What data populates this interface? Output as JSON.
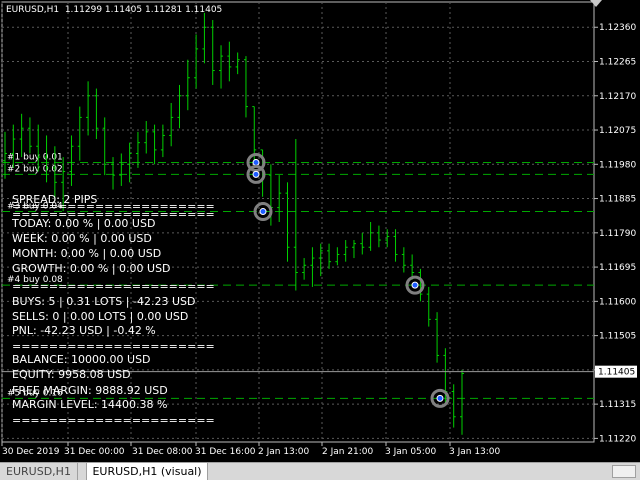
{
  "header": {
    "symbol_info": "EURUSD,H1  1.11299 1.11405 1.11281 1.11405"
  },
  "price_axis": {
    "labels": [
      "1.12360",
      "1.12265",
      "1.12170",
      "1.12075",
      "1.11980",
      "1.11885",
      "1.11790",
      "1.11695",
      "1.11600",
      "1.11505",
      "1.11410",
      "1.11315",
      "1.11220"
    ],
    "current_price": "1.11405"
  },
  "time_axis": {
    "labels": [
      "30 Dec 2019",
      "31 Dec 00:00",
      "31 Dec 08:00",
      "31 Dec 16:00",
      "2 Jan 13:00",
      "2 Jan 21:00",
      "3 Jan 05:00",
      "3 Jan 13:00"
    ]
  },
  "orders": [
    {
      "label": "#1 buy 0.01",
      "price": 1.11985
    },
    {
      "label": "#2 buy 0.02",
      "price": 1.11952
    },
    {
      "label": "#3 buy 0.04",
      "price": 1.11849
    },
    {
      "label": "#4 buy 0.08",
      "price": 1.11645
    },
    {
      "label": "#5 buy 0.16",
      "price": 1.11331
    }
  ],
  "stats_panel": {
    "lines": [
      "======================",
      "SPREAD: 2 PIPS",
      "======================",
      "TODAY: 0.00 % | 0.00 USD",
      "WEEK: 0.00 % | 0.00 USD",
      "MONTH: 0.00 % | 0.00 USD",
      "GROWTH: 0.00 % | 0.00 USD",
      "======================",
      "BUYS: 5 | 0.31 LOTS | -42.23 USD",
      "SELLS: 0 | 0.00 LOTS | 0.00 USD",
      "PNL: -42.23 USD | -0.42 %",
      "======================",
      "BALANCE: 10000.00 USD",
      "EQUITY: 9958.08 USD",
      "FREE MARGIN: 9888.92 USD",
      "MARGIN LEVEL: 14400.38 %",
      "======================"
    ]
  },
  "tabs": [
    {
      "label": "EURUSD,H1",
      "active": false
    },
    {
      "label": "EURUSD,H1 (visual)",
      "active": true
    }
  ],
  "colors": {
    "background": "#000000",
    "grid": "#5a5a5a",
    "candle": "#00d000",
    "order_line": "#00a800",
    "entry_marker_ring": "#808080",
    "entry_marker_dot": "#1e5cff",
    "price_tag_bg": "#ffffff"
  },
  "chart_data": {
    "type": "line",
    "title": "EURUSD,H1",
    "x": [
      "30 Dec 2019",
      "31 Dec 00:00",
      "31 Dec 08:00",
      "31 Dec 16:00",
      "2 Jan 13:00",
      "2 Jan 21:00",
      "3 Jan 05:00",
      "3 Jan 13:00"
    ],
    "ylim": [
      1.1121,
      1.1243
    ],
    "series": [
      {
        "name": "EURUSD,H1",
        "values": [
          [
            1.1199,
            1.1207,
            1.1194,
            1.1201
          ],
          [
            1.1201,
            1.1209,
            1.1197,
            1.1205
          ],
          [
            1.1205,
            1.1212,
            1.12,
            1.1208
          ],
          [
            1.1208,
            1.1211,
            1.1201,
            1.1203
          ],
          [
            1.1203,
            1.1209,
            1.1196,
            1.12
          ],
          [
            1.12,
            1.1206,
            1.1193,
            1.1197
          ],
          [
            1.1197,
            1.1203,
            1.1188,
            1.1193
          ],
          [
            1.1193,
            1.12,
            1.1185,
            1.1196
          ],
          [
            1.1196,
            1.1206,
            1.1192,
            1.1203
          ],
          [
            1.1203,
            1.1214,
            1.1199,
            1.1211
          ],
          [
            1.1211,
            1.1221,
            1.1206,
            1.1217
          ],
          [
            1.1217,
            1.1219,
            1.1205,
            1.1208
          ],
          [
            1.1208,
            1.1211,
            1.1195,
            1.1198
          ],
          [
            1.1198,
            1.12,
            1.1191,
            1.1195
          ],
          [
            1.1195,
            1.1201,
            1.1192,
            1.1198
          ],
          [
            1.1198,
            1.1204,
            1.1193,
            1.1201
          ],
          [
            1.1201,
            1.1207,
            1.1197,
            1.1204
          ],
          [
            1.1204,
            1.121,
            1.1201,
            1.1207
          ],
          [
            1.1207,
            1.1209,
            1.1198,
            1.1202
          ],
          [
            1.1202,
            1.1209,
            1.12,
            1.1206
          ],
          [
            1.1206,
            1.1215,
            1.1203,
            1.1211
          ],
          [
            1.1211,
            1.122,
            1.1208,
            1.1217
          ],
          [
            1.1217,
            1.1227,
            1.1213,
            1.1222
          ],
          [
            1.1222,
            1.1234,
            1.1219,
            1.123
          ],
          [
            1.123,
            1.124,
            1.1226,
            1.1236
          ],
          [
            1.1236,
            1.1238,
            1.122,
            1.1224
          ],
          [
            1.1224,
            1.1231,
            1.1219,
            1.1228
          ],
          [
            1.1228,
            1.1232,
            1.1221,
            1.1225
          ],
          [
            1.1225,
            1.1229,
            1.1223,
            1.1227
          ],
          [
            1.1227,
            1.1228,
            1.1211,
            1.1214
          ],
          [
            1.1214,
            1.1214,
            1.1198,
            1.1202
          ],
          [
            1.1202,
            1.1202,
            1.1189,
            1.1195
          ],
          [
            1.1195,
            1.1198,
            1.1181,
            1.1186
          ],
          [
            1.1186,
            1.1195,
            1.1182,
            1.119
          ],
          [
            1.119,
            1.1193,
            1.1171,
            1.1175
          ],
          [
            1.1175,
            1.1205,
            1.1163,
            1.1168
          ],
          [
            1.1168,
            1.1172,
            1.1166,
            1.117
          ],
          [
            1.117,
            1.1175,
            1.1164,
            1.1172
          ],
          [
            1.1172,
            1.1176,
            1.1167,
            1.1174
          ],
          [
            1.1174,
            1.1176,
            1.1169,
            1.1171
          ],
          [
            1.1171,
            1.1175,
            1.117,
            1.1173
          ],
          [
            1.1173,
            1.1177,
            1.1171,
            1.1175
          ],
          [
            1.1175,
            1.1177,
            1.1172,
            1.1176
          ],
          [
            1.1176,
            1.1179,
            1.1173,
            1.1175
          ],
          [
            1.1175,
            1.1182,
            1.1174,
            1.1179
          ],
          [
            1.1179,
            1.1181,
            1.1175,
            1.1177
          ],
          [
            1.1177,
            1.118,
            1.1175,
            1.1178
          ],
          [
            1.1178,
            1.118,
            1.1171,
            1.1173
          ],
          [
            1.1173,
            1.1175,
            1.1168,
            1.117
          ],
          [
            1.117,
            1.1173,
            1.1166,
            1.1168
          ],
          [
            1.1168,
            1.1169,
            1.116,
            1.1162
          ],
          [
            1.1162,
            1.1164,
            1.1153,
            1.1155
          ],
          [
            1.1155,
            1.1157,
            1.1143,
            1.1145
          ],
          [
            1.1145,
            1.1147,
            1.1132,
            1.1135
          ],
          [
            1.1135,
            1.1137,
            1.1125,
            1.1128
          ],
          [
            1.1128,
            1.1141,
            1.1123,
            1.114
          ]
        ]
      }
    ],
    "xlabel": "",
    "ylabel": "",
    "grid": true
  }
}
